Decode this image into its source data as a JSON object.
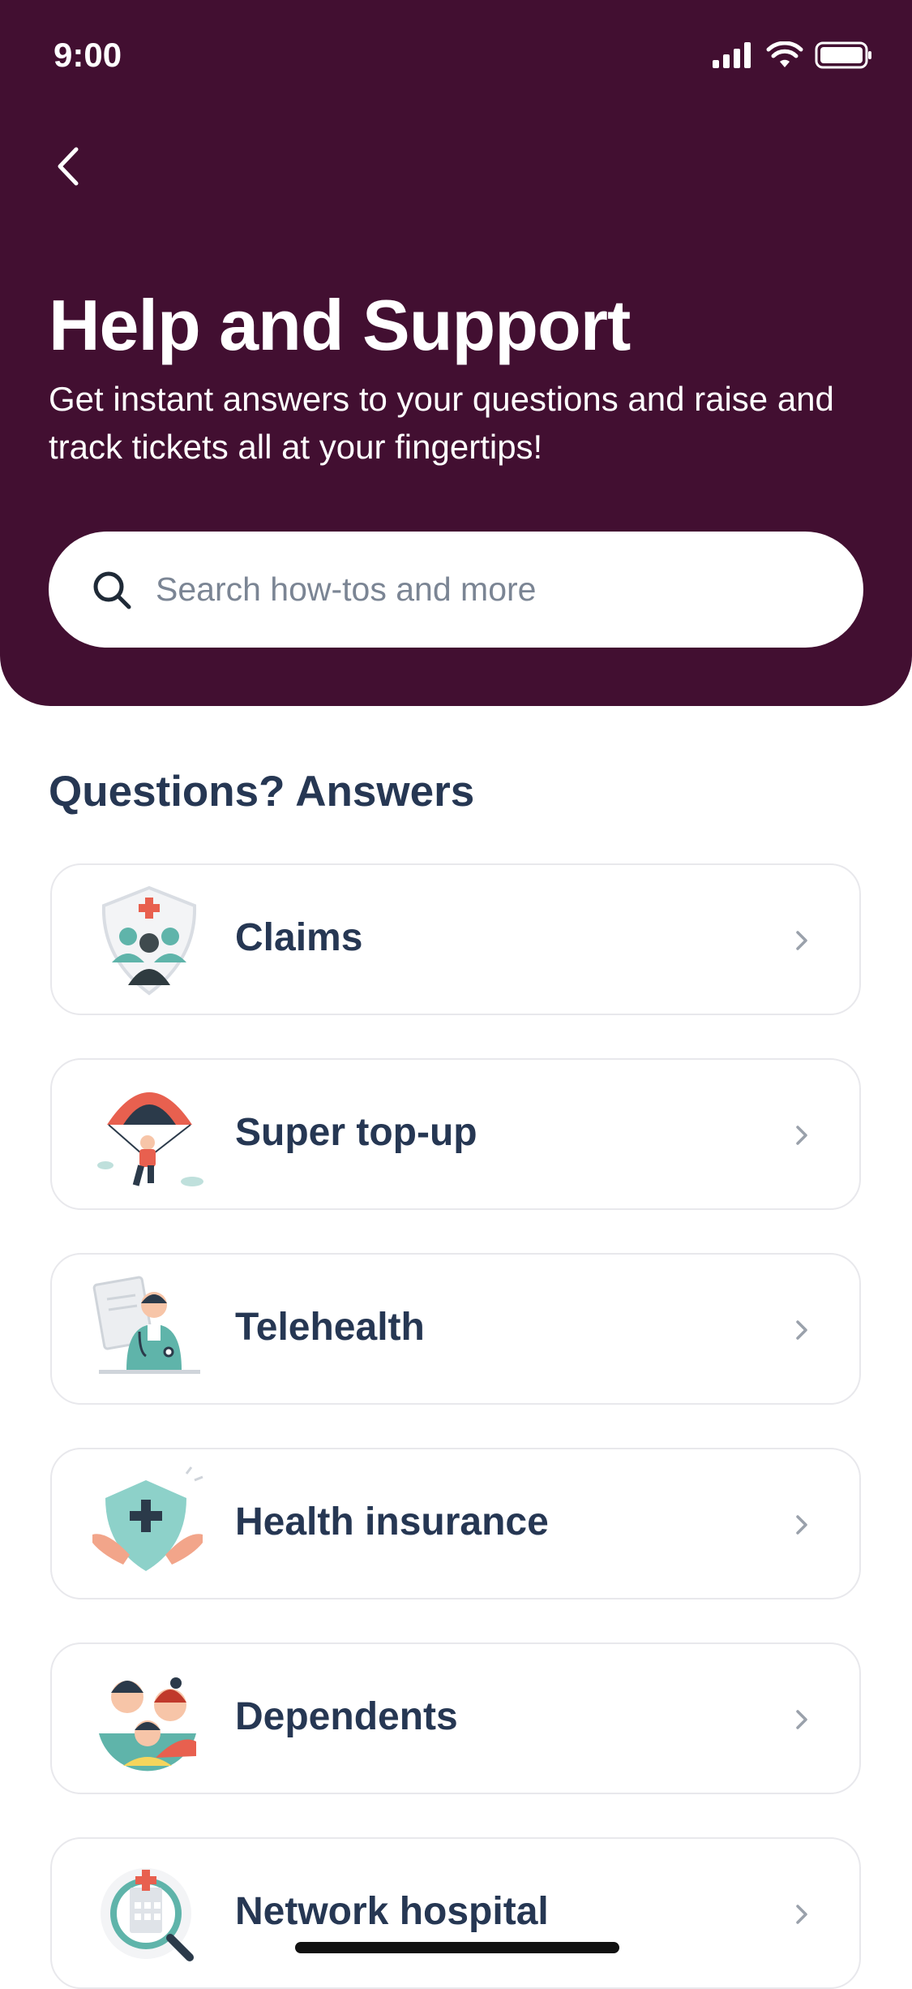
{
  "status_bar": {
    "time": "9:00"
  },
  "header": {
    "title": "Help and Support",
    "subtitle": "Get instant answers to your questions and raise and track tickets all at your fingertips!"
  },
  "search": {
    "placeholder": "Search how-tos and more",
    "icon": "search-icon"
  },
  "section": {
    "title": "Questions? Answers"
  },
  "items": [
    {
      "label": "Claims",
      "icon": "claims-shield-icon"
    },
    {
      "label": "Super top-up",
      "icon": "parachute-icon"
    },
    {
      "label": "Telehealth",
      "icon": "doctor-icon"
    },
    {
      "label": "Health insurance",
      "icon": "insurance-hands-icon"
    },
    {
      "label": "Dependents",
      "icon": "family-icon"
    },
    {
      "label": "Network hospital",
      "icon": "hospital-search-icon"
    }
  ],
  "colors": {
    "header_bg": "#420f31",
    "text_dark": "#263753",
    "accent_teal": "#5fb4aa",
    "accent_red": "#e8604f"
  }
}
